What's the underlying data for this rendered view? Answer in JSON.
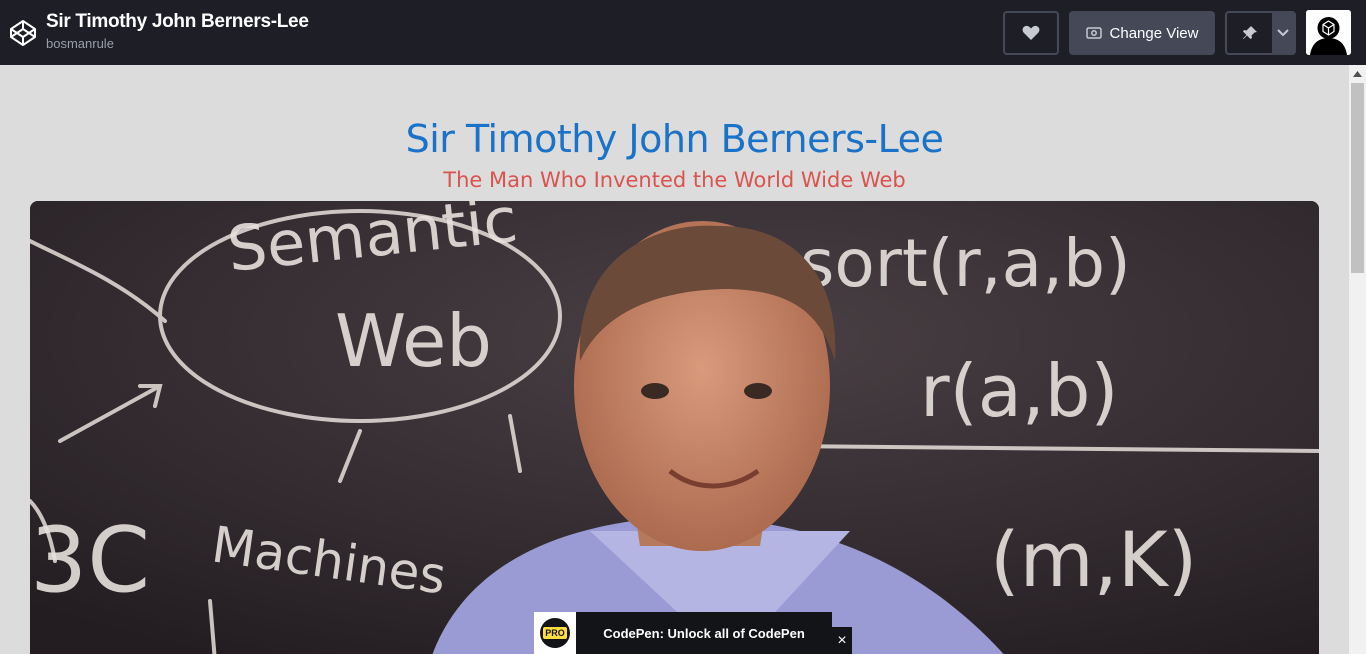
{
  "header": {
    "pen_title": "Sir Timothy John Berners-Lee",
    "author": "bosmanrule",
    "change_view_label": "Change View"
  },
  "page": {
    "title": "Sir Timothy John Berners-Lee",
    "subtitle": "The Man Who Invented the World Wide Web"
  },
  "banner": {
    "badge": "PRO",
    "text": "CodePen: Unlock all of CodePen",
    "close": "×"
  },
  "photo": {
    "chalk_text": [
      "Semantic",
      "Web",
      "sort(r,a,b)",
      "r(a,b)",
      "Machines",
      "3C",
      "(m,K)"
    ]
  }
}
